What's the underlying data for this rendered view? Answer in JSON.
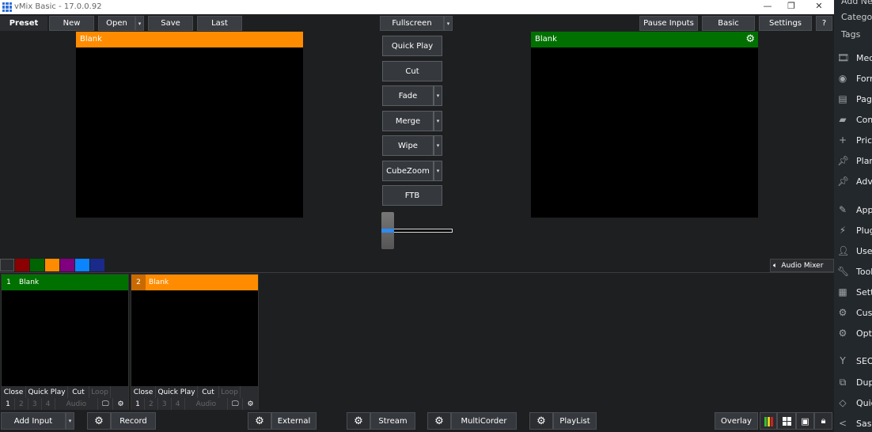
{
  "titlebar": {
    "title": "vMix Basic - 17.0.0.92",
    "minimize": "—",
    "restore": "❐",
    "close": "✕"
  },
  "toolbar": {
    "preset": "Preset",
    "new": "New",
    "open": "Open",
    "save": "Save",
    "last": "Last",
    "fullscreen": "Fullscreen",
    "pause_inputs": "Pause Inputs",
    "basic": "Basic",
    "settings": "Settings",
    "help": "?",
    "caret": "▾"
  },
  "preview": {
    "title": "Blank",
    "color": "#ff8c00"
  },
  "output": {
    "title": "Blank",
    "color": "#007000"
  },
  "transitions": {
    "quick_play": "Quick Play",
    "cut": "Cut",
    "fade": "Fade",
    "merge": "Merge",
    "wipe": "Wipe",
    "cubezoom": "CubeZoom",
    "ftb": "FTB"
  },
  "tbar_position": 0,
  "swatch_colors": [
    "#2b2d31",
    "#8b0000",
    "#006400",
    "#ff8c00",
    "#800080",
    "#0a84ff",
    "#1a2a8a"
  ],
  "audio_mixer": "Audio Mixer",
  "inputs": [
    {
      "number": "1",
      "title": "Blank",
      "color": "#007000",
      "controls": [
        "Close",
        "Quick Play",
        "Cut",
        "Loop"
      ],
      "overlays": [
        "1",
        "2",
        "3",
        "4"
      ],
      "audio": "Audio"
    },
    {
      "number": "2",
      "title": "Blank",
      "color": "#ff8c00",
      "controls": [
        "Close",
        "Quick Play",
        "Cut",
        "Loop"
      ],
      "overlays": [
        "1",
        "2",
        "3",
        "4"
      ],
      "audio": "Audio"
    }
  ],
  "bottom": {
    "add_input": "Add Input",
    "record": "Record",
    "external": "External",
    "stream": "Stream",
    "multicorder": "MultiCorder",
    "playlist": "PlayList",
    "overlay": "Overlay"
  },
  "wp_sidebar": {
    "top": [
      "Add New",
      "Categories",
      "Tags"
    ],
    "items": [
      {
        "icon": "media-icon",
        "label": "Media"
      },
      {
        "icon": "forms-icon",
        "label": "Forms"
      },
      {
        "icon": "pages-icon",
        "label": "Pages"
      },
      {
        "icon": "comments-icon",
        "label": "Comments"
      },
      {
        "icon": "plus-icon",
        "label": "Pricing"
      },
      {
        "icon": "pin-icon",
        "label": "Plans"
      },
      {
        "icon": "pin-icon",
        "label": "Adverts"
      },
      {
        "icon": "appearance-icon",
        "label": "Appearance"
      },
      {
        "icon": "plugins-icon",
        "label": "Plugins"
      },
      {
        "icon": "users-icon",
        "label": "Users"
      },
      {
        "icon": "tools-icon",
        "label": "Tools"
      },
      {
        "icon": "settings-icon",
        "label": "Settings"
      },
      {
        "icon": "gear-icon",
        "label": "Custom"
      },
      {
        "icon": "gear-icon",
        "label": "Options"
      },
      {
        "icon": "seo-icon",
        "label": "SEO"
      },
      {
        "icon": "duplicate-icon",
        "label": "Duplicate"
      },
      {
        "icon": "quick-icon",
        "label": "Quick"
      },
      {
        "icon": "share-icon",
        "label": "Sassy"
      }
    ]
  }
}
